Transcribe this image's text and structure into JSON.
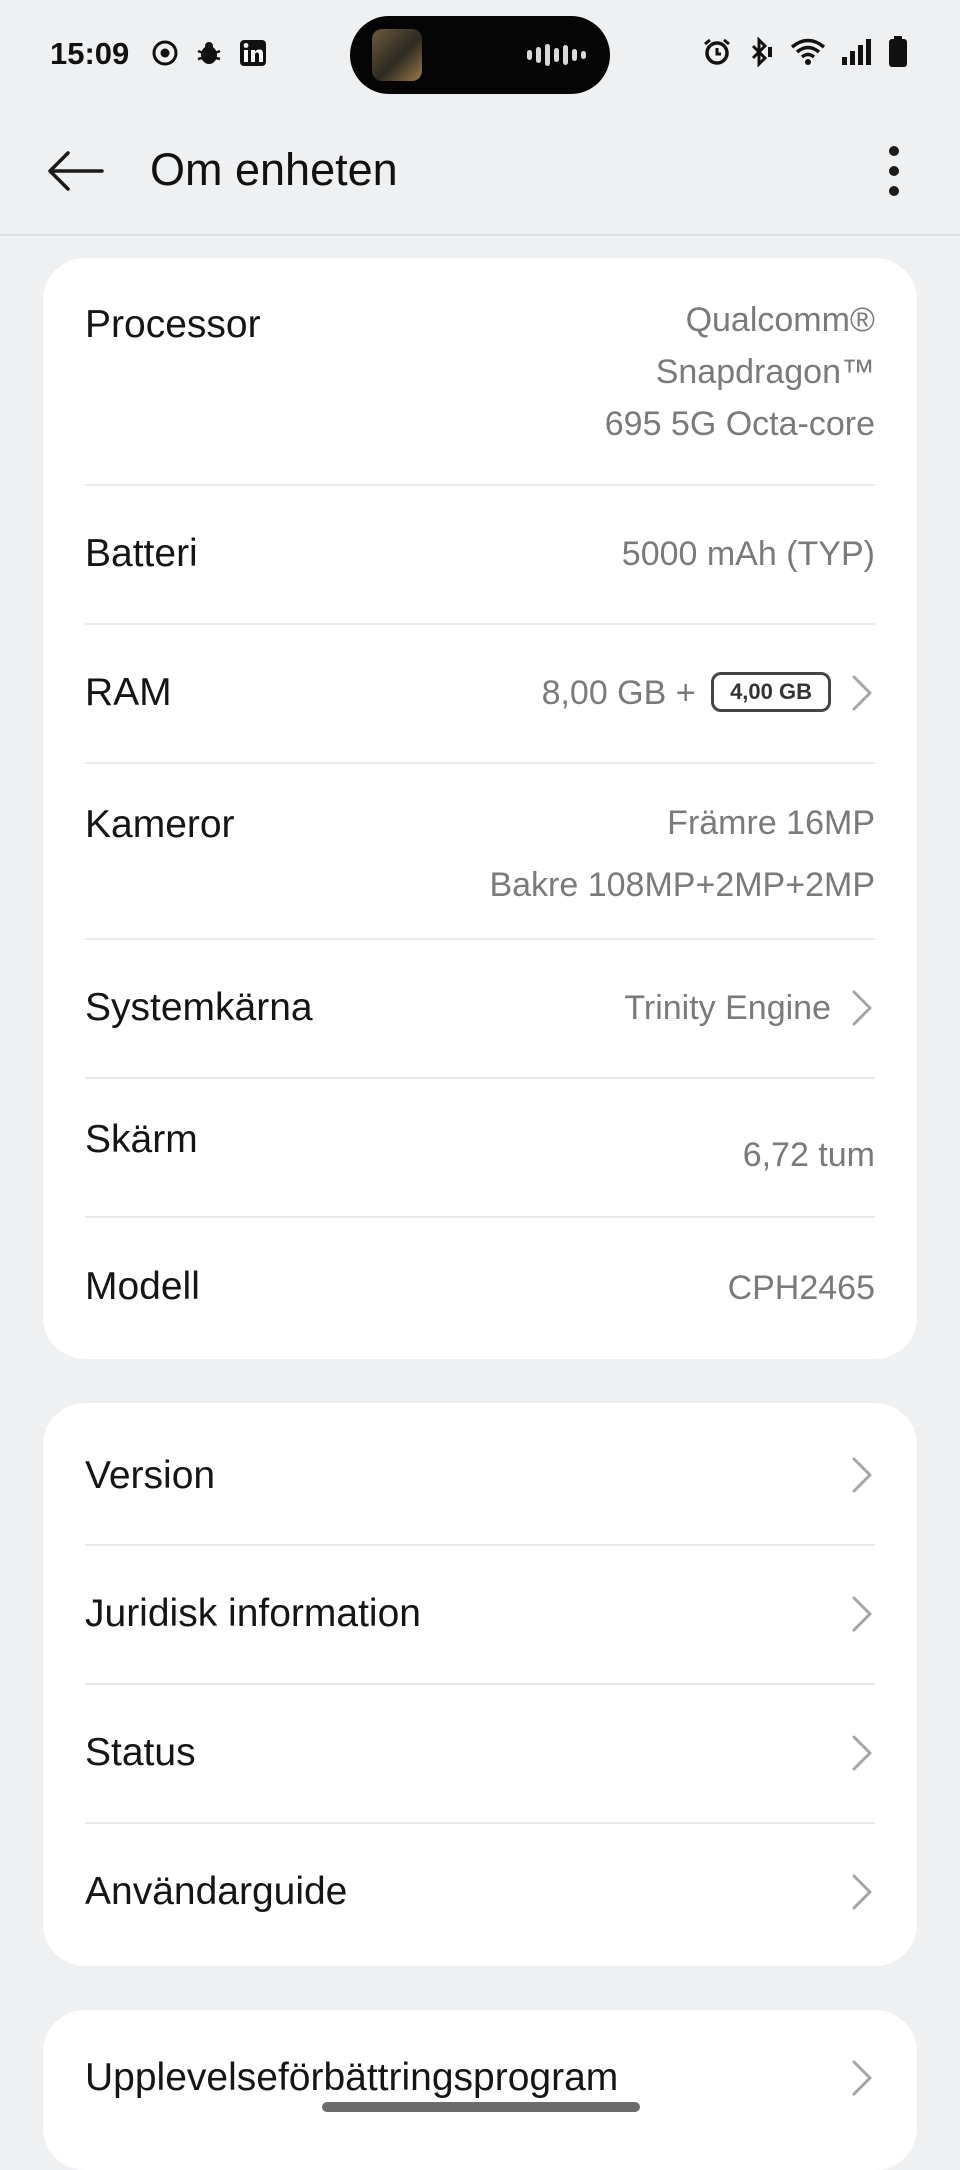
{
  "status_bar": {
    "time": "15:09",
    "left_icons": [
      "chrome-icon",
      "bug-icon",
      "linkedin-icon"
    ],
    "right_icons": [
      "alarm-icon",
      "bluetooth-icon",
      "wifi-icon",
      "signal-icon",
      "battery-icon"
    ]
  },
  "header": {
    "title": "Om enheten"
  },
  "specs": [
    {
      "label": "Processor",
      "value_lines": [
        "Qualcomm®",
        "Snapdragon™",
        "695 5G Octa-core"
      ]
    },
    {
      "label": "Batteri",
      "value": "5000 mAh (TYP)"
    },
    {
      "label": "RAM",
      "value": "8,00 GB +",
      "badge": "4,00 GB",
      "has_chevron": true
    },
    {
      "label": "Kameror",
      "value_lines": [
        "Främre 16MP",
        "Bakre 108MP+2MP+2MP"
      ]
    },
    {
      "label": "Systemkärna",
      "value": "Trinity Engine",
      "has_chevron": true
    },
    {
      "label": "Skärm",
      "value": "6,72 tum"
    },
    {
      "label": "Modell",
      "value": "CPH2465"
    }
  ],
  "links": [
    {
      "label": "Version"
    },
    {
      "label": "Juridisk information"
    },
    {
      "label": "Status"
    },
    {
      "label": "Användarguide"
    }
  ],
  "extra": [
    {
      "label": "Upplevelseförbättringsprogram"
    }
  ],
  "colors": {
    "background": "#eff0f2",
    "card": "#ffffff",
    "secondary_text": "#7a7a7a",
    "chevron": "#a5a5a5"
  }
}
